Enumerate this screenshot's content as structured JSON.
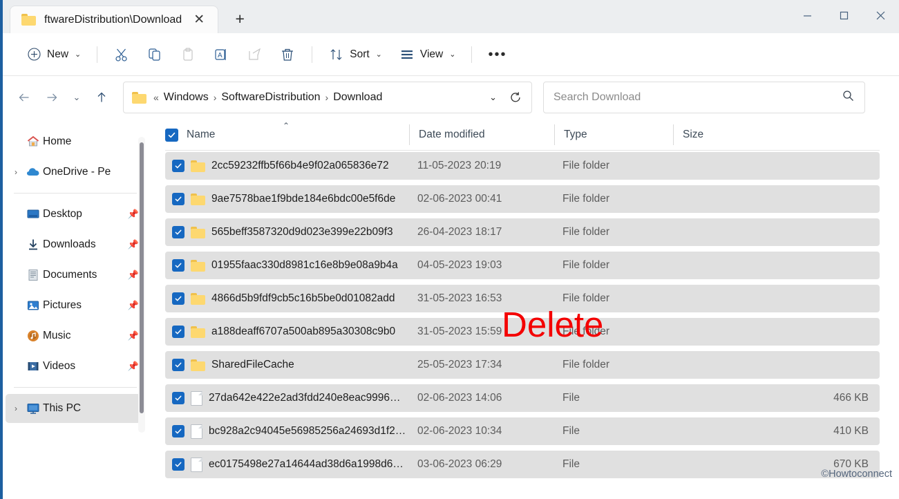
{
  "window": {
    "tab_title": "ftwareDistribution\\Download",
    "tab_close_label": "✕",
    "new_tab_label": "+",
    "minimize_label": "─",
    "maximize_label": "□",
    "close_label": "✕"
  },
  "toolbar": {
    "new_label": "New",
    "new_chevron": "⌄",
    "cut_label": "Cut",
    "copy_label": "Copy",
    "paste_label": "Paste",
    "rename_label": "Rename",
    "share_label": "Share",
    "delete_label": "Delete",
    "sort_label": "Sort",
    "sort_chevron": "⌄",
    "view_label": "View",
    "view_chevron": "⌄",
    "more_label": "•••"
  },
  "nav": {
    "back_label": "←",
    "forward_label": "→",
    "recent_label": "⌄",
    "up_label": "↑",
    "address_prefix": "«",
    "breadcrumbs": [
      "Windows",
      "SoftwareDistribution",
      "Download"
    ],
    "separator": "›",
    "address_chevron": "⌄",
    "refresh_label": "↻"
  },
  "search": {
    "placeholder": "Search Download",
    "value": "",
    "icon": "🔍"
  },
  "sidebar": {
    "items": [
      {
        "label": "Home",
        "icon": "home-icon",
        "expander": "",
        "pin": "",
        "selected": false
      },
      {
        "label": "OneDrive - Pe",
        "icon": "onedrive-icon",
        "expander": "›",
        "pin": "",
        "selected": false
      },
      {
        "label": "Desktop",
        "icon": "desktop-icon",
        "expander": "",
        "pin": "📌",
        "selected": false
      },
      {
        "label": "Downloads",
        "icon": "downloads-icon",
        "expander": "",
        "pin": "📌",
        "selected": false
      },
      {
        "label": "Documents",
        "icon": "documents-icon",
        "expander": "",
        "pin": "📌",
        "selected": false
      },
      {
        "label": "Pictures",
        "icon": "pictures-icon",
        "expander": "",
        "pin": "📌",
        "selected": false
      },
      {
        "label": "Music",
        "icon": "music-icon",
        "expander": "",
        "pin": "📌",
        "selected": false
      },
      {
        "label": "Videos",
        "icon": "videos-icon",
        "expander": "",
        "pin": "📌",
        "selected": false
      },
      {
        "label": "This PC",
        "icon": "thispc-icon",
        "expander": "›",
        "pin": "",
        "selected": true
      }
    ]
  },
  "filelist": {
    "columns": {
      "name": "Name",
      "date_modified": "Date modified",
      "type": "Type",
      "size": "Size"
    },
    "sort_indicator": "⌃",
    "select_all_checked": true,
    "rows": [
      {
        "name": "2cc59232ffb5f66b4e9f02a065836e72",
        "date": "11-05-2023 20:19",
        "type": "File folder",
        "size": "",
        "kind": "folder",
        "checked": true
      },
      {
        "name": "9ae7578bae1f9bde184e6bdc00e5f6de",
        "date": "02-06-2023 00:41",
        "type": "File folder",
        "size": "",
        "kind": "folder",
        "checked": true
      },
      {
        "name": "565beff3587320d9d023e399e22b09f3",
        "date": "26-04-2023 18:17",
        "type": "File folder",
        "size": "",
        "kind": "folder",
        "checked": true
      },
      {
        "name": "01955faac330d8981c16e8b9e08a9b4a",
        "date": "04-05-2023 19:03",
        "type": "File folder",
        "size": "",
        "kind": "folder",
        "checked": true
      },
      {
        "name": "4866d5b9fdf9cb5c16b5be0d01082add",
        "date": "31-05-2023 16:53",
        "type": "File folder",
        "size": "",
        "kind": "folder",
        "checked": true
      },
      {
        "name": "a188deaff6707a500ab895a30308c9b0",
        "date": "31-05-2023 15:59",
        "type": "File folder",
        "size": "",
        "kind": "folder",
        "checked": true
      },
      {
        "name": "SharedFileCache",
        "date": "25-05-2023 17:34",
        "type": "File folder",
        "size": "",
        "kind": "folder",
        "checked": true
      },
      {
        "name": "27da642e422e2ad3fdd240e8eac9996…",
        "date": "02-06-2023 14:06",
        "type": "File",
        "size": "466 KB",
        "kind": "file",
        "checked": true
      },
      {
        "name": "bc928a2c94045e56985256a24693d1f2…",
        "date": "02-06-2023 10:34",
        "type": "File",
        "size": "410 KB",
        "kind": "file",
        "checked": true
      },
      {
        "name": "ec0175498e27a14644ad38d6a1998d6…",
        "date": "03-06-2023 06:29",
        "type": "File",
        "size": "670 KB",
        "kind": "file",
        "checked": true
      }
    ]
  },
  "annotations": {
    "delete_text": "Delete",
    "delete_color": "#f40000",
    "watermark": "©Howtoconnect"
  }
}
